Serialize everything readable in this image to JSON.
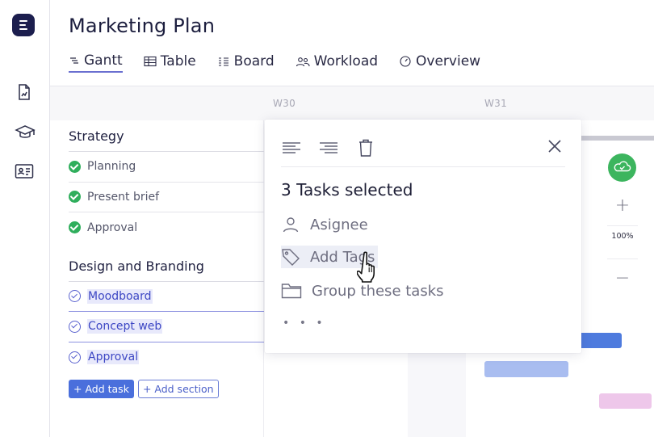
{
  "app": {
    "title": "Marketing Plan"
  },
  "sidebar": {
    "items": [
      {
        "icon": "document-chart-icon"
      },
      {
        "icon": "graduation-cap-icon"
      },
      {
        "icon": "contact-card-icon"
      }
    ]
  },
  "tabs": [
    {
      "label": "Gantt",
      "icon": "gantt-icon",
      "active": true
    },
    {
      "label": "Table",
      "icon": "table-icon",
      "active": false
    },
    {
      "label": "Board",
      "icon": "board-icon",
      "active": false
    },
    {
      "label": "Workload",
      "icon": "people-icon",
      "active": false
    },
    {
      "label": "Overview",
      "icon": "gauge-icon",
      "active": false
    }
  ],
  "timeline": {
    "weeks": [
      "W30",
      "W31"
    ]
  },
  "sections": [
    {
      "title": "Strategy",
      "tasks": [
        {
          "label": "Planning",
          "status": "done"
        },
        {
          "label": "Present brief",
          "status": "done"
        },
        {
          "label": "Approval",
          "status": "done"
        }
      ]
    },
    {
      "title": "Design and Branding",
      "tasks": [
        {
          "label": "Moodboard",
          "status": "selected"
        },
        {
          "label": "Concept web",
          "status": "selected"
        },
        {
          "label": "Approval",
          "status": "selected"
        }
      ]
    }
  ],
  "buttons": {
    "add_task": "+ Add task",
    "add_section": "+ Add section"
  },
  "zoom": {
    "plus": "+",
    "level": "100%",
    "minus": "−"
  },
  "popup": {
    "heading": "3 Tasks selected",
    "tools": [
      "align-left-icon",
      "align-right-icon",
      "trash-icon"
    ],
    "items": [
      {
        "label": "Asignee",
        "icon": "person-icon"
      },
      {
        "label": "Add Tags",
        "icon": "tag-icon"
      },
      {
        "label": "Group these tasks",
        "icon": "folder-icon"
      }
    ],
    "more": "• • •"
  },
  "colors": {
    "accent": "#4a6fdc",
    "done_green": "#2fae5c",
    "selected_blue": "#3d47c4",
    "bar_blue": "#4e7bde",
    "bar_light_blue": "#a9bdf0",
    "bar_pink": "#eec7ea",
    "logo": "#1c1e4e"
  }
}
